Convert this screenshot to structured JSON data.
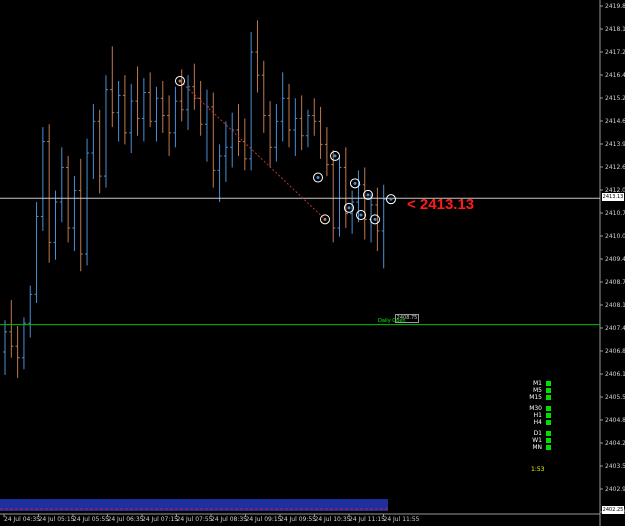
{
  "chart_data": {
    "type": "candlestick",
    "price_axis": {
      "min": 2402.25,
      "max": 2419.8,
      "ticks": [
        "2419.80",
        "2418.15",
        "2417.20",
        "2416.45",
        "2415.25",
        "2414.60",
        "2413.95",
        "2412.65",
        "2412.00",
        "2410.70",
        "2410.05",
        "2409.40",
        "2408.75",
        "2408.10",
        "2407.45",
        "2406.80",
        "2406.15",
        "2405.50",
        "2404.85",
        "2404.20",
        "2403.55",
        "2402.90",
        "2402.25"
      ]
    },
    "time_axis": {
      "labels": [
        "24 Jul 04:35",
        "24 Jul 05:15",
        "24 Jul 05:55",
        "24 Jul 06:35",
        "24 Jul 07:15",
        "24 Jul 07:55",
        "24 Jul 08:35",
        "24 Jul 09:15",
        "24 Jul 09:55",
        "24 Jul 10:35",
        "24 Jul 11:15",
        "24 Jul 11:55"
      ]
    },
    "candles": [
      [
        2407.8,
        2408.9,
        2407.0,
        2408.5
      ],
      [
        2408.5,
        2409.6,
        2407.6,
        2408.0
      ],
      [
        2408.0,
        2408.7,
        2406.9,
        2407.6
      ],
      [
        2407.6,
        2409.0,
        2407.2,
        2408.8
      ],
      [
        2408.8,
        2410.1,
        2408.3,
        2409.8
      ],
      [
        2409.8,
        2413.0,
        2409.5,
        2412.5
      ],
      [
        2412.5,
        2415.6,
        2412.0,
        2415.1
      ],
      [
        2415.1,
        2415.7,
        2410.9,
        2411.6
      ],
      [
        2411.6,
        2413.4,
        2411.0,
        2413.0
      ],
      [
        2413.0,
        2414.9,
        2412.3,
        2414.2
      ],
      [
        2414.2,
        2414.6,
        2411.6,
        2412.1
      ],
      [
        2412.1,
        2413.9,
        2411.3,
        2413.4
      ],
      [
        2413.4,
        2414.5,
        2410.6,
        2411.2
      ],
      [
        2411.2,
        2415.2,
        2410.8,
        2414.7
      ],
      [
        2414.7,
        2416.4,
        2413.8,
        2415.8
      ],
      [
        2415.8,
        2416.2,
        2413.3,
        2413.9
      ],
      [
        2413.9,
        2417.4,
        2413.5,
        2416.9
      ],
      [
        2416.9,
        2418.4,
        2415.6,
        2416.1
      ],
      [
        2416.1,
        2417.2,
        2415.1,
        2416.7
      ],
      [
        2416.7,
        2417.4,
        2415.0,
        2415.4
      ],
      [
        2415.4,
        2417.1,
        2414.7,
        2416.5
      ],
      [
        2416.5,
        2417.7,
        2415.3,
        2415.9
      ],
      [
        2415.9,
        2417.3,
        2415.1,
        2416.8
      ],
      [
        2416.8,
        2417.5,
        2415.6,
        2415.8
      ],
      [
        2415.8,
        2417.0,
        2415.1,
        2416.6
      ],
      [
        2416.6,
        2417.2,
        2415.4,
        2416.0
      ],
      [
        2416.0,
        2416.7,
        2414.6,
        2415.4
      ],
      [
        2415.4,
        2417.0,
        2414.9,
        2416.5
      ],
      [
        2416.5,
        2417.6,
        2415.8,
        2416.2
      ],
      [
        2416.2,
        2417.4,
        2415.5,
        2417.0
      ],
      [
        2417.0,
        2417.8,
        2416.2,
        2416.6
      ],
      [
        2416.6,
        2417.2,
        2415.3,
        2415.7
      ],
      [
        2415.7,
        2416.9,
        2414.4,
        2416.3
      ],
      [
        2416.3,
        2416.8,
        2413.5,
        2414.1
      ],
      [
        2414.1,
        2415.0,
        2413.0,
        2414.6
      ],
      [
        2414.6,
        2415.8,
        2413.7,
        2414.9
      ],
      [
        2414.9,
        2416.1,
        2414.2,
        2415.5
      ],
      [
        2415.5,
        2416.4,
        2414.6,
        2415.1
      ],
      [
        2415.1,
        2415.9,
        2414.1,
        2414.5
      ],
      [
        2414.5,
        2418.9,
        2414.1,
        2418.2
      ],
      [
        2418.2,
        2419.3,
        2416.8,
        2417.4
      ],
      [
        2417.4,
        2417.9,
        2415.4,
        2416.0
      ],
      [
        2416.0,
        2416.5,
        2414.2,
        2414.9
      ],
      [
        2414.9,
        2416.4,
        2414.4,
        2415.8
      ],
      [
        2415.8,
        2417.5,
        2415.1,
        2416.6
      ],
      [
        2416.6,
        2417.1,
        2414.9,
        2415.5
      ],
      [
        2415.5,
        2416.6,
        2414.6,
        2415.9
      ],
      [
        2415.9,
        2416.7,
        2414.8,
        2415.3
      ],
      [
        2415.3,
        2416.2,
        2414.9,
        2416.0
      ],
      [
        2416.0,
        2416.6,
        2415.3,
        2415.8
      ],
      [
        2415.8,
        2416.3,
        2414.5,
        2415.0
      ],
      [
        2415.0,
        2415.6,
        2413.9,
        2414.3
      ],
      [
        2414.3,
        2414.8,
        2411.6,
        2412.1
      ],
      [
        2412.1,
        2414.6,
        2411.8,
        2414.2
      ],
      [
        2414.2,
        2414.9,
        2412.1,
        2412.6
      ],
      [
        2412.6,
        2413.4,
        2411.9,
        2413.0
      ],
      [
        2413.0,
        2414.1,
        2412.3,
        2413.6
      ],
      [
        2413.6,
        2414.2,
        2411.7,
        2412.4
      ],
      [
        2412.4,
        2413.3,
        2411.6,
        2412.9
      ],
      [
        2412.9,
        2413.5,
        2411.3,
        2412.0
      ],
      [
        2412.0,
        2413.6,
        2410.7,
        2413.1
      ]
    ],
    "horizontal_lines": [
      {
        "price": 2413.13,
        "color": "#c8c8c8"
      },
      {
        "price": 2408.75,
        "color": "#00c000"
      }
    ],
    "colors": {
      "bull": "#4a8fd6",
      "bear": "#c07a50",
      "bg": "#000000",
      "grid": "#303030",
      "volume_band": "#1f2fa0"
    }
  },
  "price_callout": "< 2413.13",
  "bid_box": "2413.13",
  "last_box": "2402.25",
  "hl_name": "Daily Open",
  "hl_tag": "2408.75",
  "timeframes": {
    "group1": [
      "M1",
      "M5",
      "M15"
    ],
    "group2": [
      "M30",
      "H1",
      "H4"
    ],
    "group3": [
      "D1",
      "W1",
      "MN"
    ],
    "clock": "1:53"
  }
}
